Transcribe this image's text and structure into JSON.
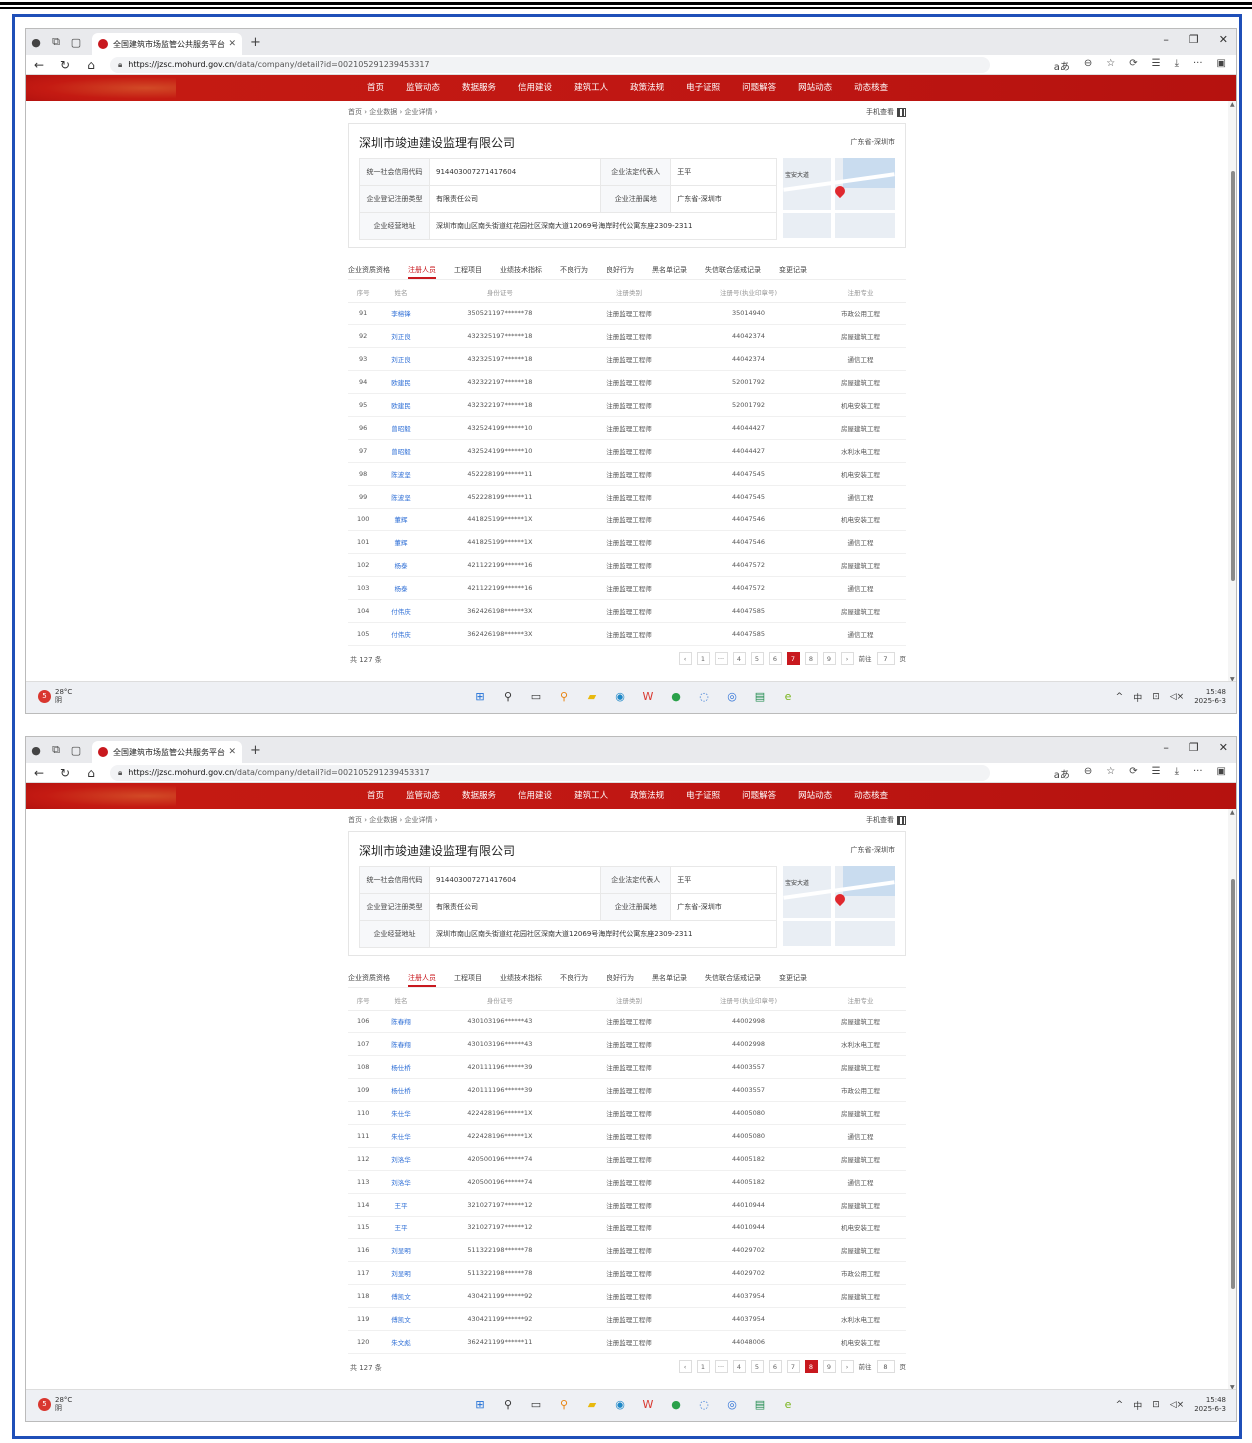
{
  "browser": {
    "tab_title": "全国建筑市场监管公共服务平台",
    "url_host": "https://jzsc.mohurd.gov.cn",
    "url_path": "/data/company/detail?id=002105291239453317"
  },
  "nav": [
    "首页",
    "监管动态",
    "数据服务",
    "信用建设",
    "建筑工人",
    "政策法规",
    "电子证照",
    "问题解答",
    "网站动态",
    "动态核查"
  ],
  "breadcrumb": "首页 › 企业数据 › 企业详情 ›",
  "mobile_view": "手机查看",
  "company": {
    "name": "深圳市竣迪建设监理有限公司",
    "region": "广东省-深圳市",
    "credit_code_label": "统一社会信用代码",
    "credit_code": "914403007271417604",
    "legal_rep_label": "企业法定代表人",
    "legal_rep": "王平",
    "reg_type_label": "企业登记注册类型",
    "reg_type": "有限责任公司",
    "reg_place_label": "企业注册属地",
    "reg_place": "广东省-深圳市",
    "address_label": "企业经营地址",
    "address": "深圳市南山区南头街道红花园社区深南大道12069号海岸时代公寓东座2309-2311",
    "map_label": "宝安大道"
  },
  "subtabs": [
    "企业资质资格",
    "注册人员",
    "工程项目",
    "业绩技术指标",
    "不良行为",
    "良好行为",
    "黑名单记录",
    "失信联合惩戒记录",
    "变更记录"
  ],
  "table_headers": [
    "序号",
    "姓名",
    "身份证号",
    "注册类别",
    "注册号(执业印章号)",
    "注册专业"
  ],
  "shots": [
    {
      "rows": [
        [
          "91",
          "李榕锋",
          "350521197******78",
          "注册监理工程师",
          "35014940",
          "市政公用工程"
        ],
        [
          "92",
          "刘正良",
          "432325197******18",
          "注册监理工程师",
          "44042374",
          "房屋建筑工程"
        ],
        [
          "93",
          "刘正良",
          "432325197******18",
          "注册监理工程师",
          "44042374",
          "通信工程"
        ],
        [
          "94",
          "欧建民",
          "432322197******18",
          "注册监理工程师",
          "52001792",
          "房屋建筑工程"
        ],
        [
          "95",
          "欧建民",
          "432322197******18",
          "注册监理工程师",
          "52001792",
          "机电安装工程"
        ],
        [
          "96",
          "曾昭毅",
          "432524199******10",
          "注册监理工程师",
          "44044427",
          "房屋建筑工程"
        ],
        [
          "97",
          "曾昭毅",
          "432524199******10",
          "注册监理工程师",
          "44044427",
          "水利水电工程"
        ],
        [
          "98",
          "陈波坚",
          "452228199******11",
          "注册监理工程师",
          "44047545",
          "机电安装工程"
        ],
        [
          "99",
          "陈波坚",
          "452228199******11",
          "注册监理工程师",
          "44047545",
          "通信工程"
        ],
        [
          "100",
          "董辉",
          "441825199******1X",
          "注册监理工程师",
          "44047546",
          "机电安装工程"
        ],
        [
          "101",
          "董辉",
          "441825199******1X",
          "注册监理工程师",
          "44047546",
          "通信工程"
        ],
        [
          "102",
          "杨泰",
          "421122199******16",
          "注册监理工程师",
          "44047572",
          "房屋建筑工程"
        ],
        [
          "103",
          "杨泰",
          "421122199******16",
          "注册监理工程师",
          "44047572",
          "通信工程"
        ],
        [
          "104",
          "付伟庆",
          "362426198******3X",
          "注册监理工程师",
          "44047585",
          "房屋建筑工程"
        ],
        [
          "105",
          "付伟庆",
          "362426198******3X",
          "注册监理工程师",
          "44047585",
          "通信工程"
        ]
      ],
      "total": "共 127 条",
      "pages": [
        "‹",
        "1",
        "···",
        "4",
        "5",
        "6",
        "7",
        "8",
        "9",
        "›"
      ],
      "current_page": "7",
      "goto_label": "前往",
      "goto_value": "7",
      "page_suffix": "页"
    },
    {
      "rows": [
        [
          "106",
          "陈春翔",
          "430103196******43",
          "注册监理工程师",
          "44002998",
          "房屋建筑工程"
        ],
        [
          "107",
          "陈春翔",
          "430103196******43",
          "注册监理工程师",
          "44002998",
          "水利水电工程"
        ],
        [
          "108",
          "杨仕桥",
          "420111196******39",
          "注册监理工程师",
          "44003557",
          "房屋建筑工程"
        ],
        [
          "109",
          "杨仕桥",
          "420111196******39",
          "注册监理工程师",
          "44003557",
          "市政公用工程"
        ],
        [
          "110",
          "朱仕华",
          "422428196******1X",
          "注册监理工程师",
          "44005080",
          "房屋建筑工程"
        ],
        [
          "111",
          "朱仕华",
          "422428196******1X",
          "注册监理工程师",
          "44005080",
          "通信工程"
        ],
        [
          "112",
          "刘洛华",
          "420500196******74",
          "注册监理工程师",
          "44005182",
          "房屋建筑工程"
        ],
        [
          "113",
          "刘洛华",
          "420500196******74",
          "注册监理工程师",
          "44005182",
          "通信工程"
        ],
        [
          "114",
          "王平",
          "321027197******12",
          "注册监理工程师",
          "44010944",
          "房屋建筑工程"
        ],
        [
          "115",
          "王平",
          "321027197******12",
          "注册监理工程师",
          "44010944",
          "机电安装工程"
        ],
        [
          "116",
          "刘显明",
          "511322198******78",
          "注册监理工程师",
          "44029702",
          "房屋建筑工程"
        ],
        [
          "117",
          "刘显明",
          "511322198******78",
          "注册监理工程师",
          "44029702",
          "市政公用工程"
        ],
        [
          "118",
          "傅凯文",
          "430421199******92",
          "注册监理工程师",
          "44037954",
          "房屋建筑工程"
        ],
        [
          "119",
          "傅凯文",
          "430421199******92",
          "注册监理工程师",
          "44037954",
          "水利水电工程"
        ],
        [
          "120",
          "朱文彪",
          "362421199******11",
          "注册监理工程师",
          "44048006",
          "机电安装工程"
        ]
      ],
      "total": "共 127 条",
      "pages": [
        "‹",
        "1",
        "···",
        "4",
        "5",
        "6",
        "7",
        "8",
        "9",
        "›"
      ],
      "current_page": "8",
      "goto_label": "前往",
      "goto_value": "8",
      "page_suffix": "页"
    }
  ],
  "taskbar": {
    "weather_temp": "28°C",
    "weather_desc": "阴",
    "weather_badge": "5",
    "ime": "中",
    "time": "15:48",
    "date": "2025-6-3"
  },
  "colors": {
    "accent_red": "#c8181e",
    "link_blue": "#2f6fd6",
    "frame_blue": "#1f4fb8"
  }
}
